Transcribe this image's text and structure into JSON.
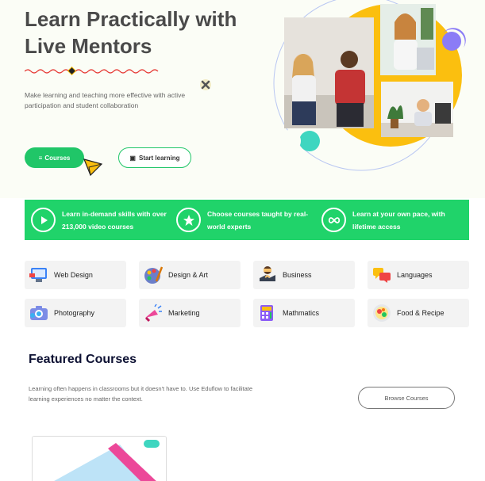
{
  "hero": {
    "title_line1": "Learn Practically with",
    "title_line2": "Live Mentors",
    "subtitle": "Make learning and teaching more effective with active participation and student collaboration",
    "btn_courses": "Courses",
    "btn_start": "Start learning"
  },
  "band": {
    "items": [
      {
        "icon": "play-icon",
        "text": "Learn in-demand skills with over 213,000 video courses"
      },
      {
        "icon": "star-icon",
        "text": "Choose courses taught by real-world experts"
      },
      {
        "icon": "infinity-icon",
        "text": "Learn at your own pace, with lifetime access"
      }
    ]
  },
  "categories": [
    {
      "label": "Web Design",
      "icon": "web-design-icon"
    },
    {
      "label": "Design & Art",
      "icon": "palette-icon"
    },
    {
      "label": "Business",
      "icon": "handshake-icon"
    },
    {
      "label": "Languages",
      "icon": "speech-bubbles-icon"
    },
    {
      "label": "Photography",
      "icon": "camera-icon"
    },
    {
      "label": "Marketing",
      "icon": "megaphone-icon"
    },
    {
      "label": "Mathmatics",
      "icon": "calculator-icon"
    },
    {
      "label": "Food & Recipe",
      "icon": "food-plate-icon"
    }
  ],
  "featured": {
    "title": "Featured Courses",
    "subtitle": "Learning often happens in classrooms but it doesn't have to. Use Eduflow to facilitate learning experiences no matter the context.",
    "browse_label": "Browse Courses"
  },
  "colors": {
    "brand_green": "#20c668",
    "band_green": "#20d36a",
    "accent_yellow": "#fbbf0f",
    "heading_navy": "#0d1133"
  }
}
